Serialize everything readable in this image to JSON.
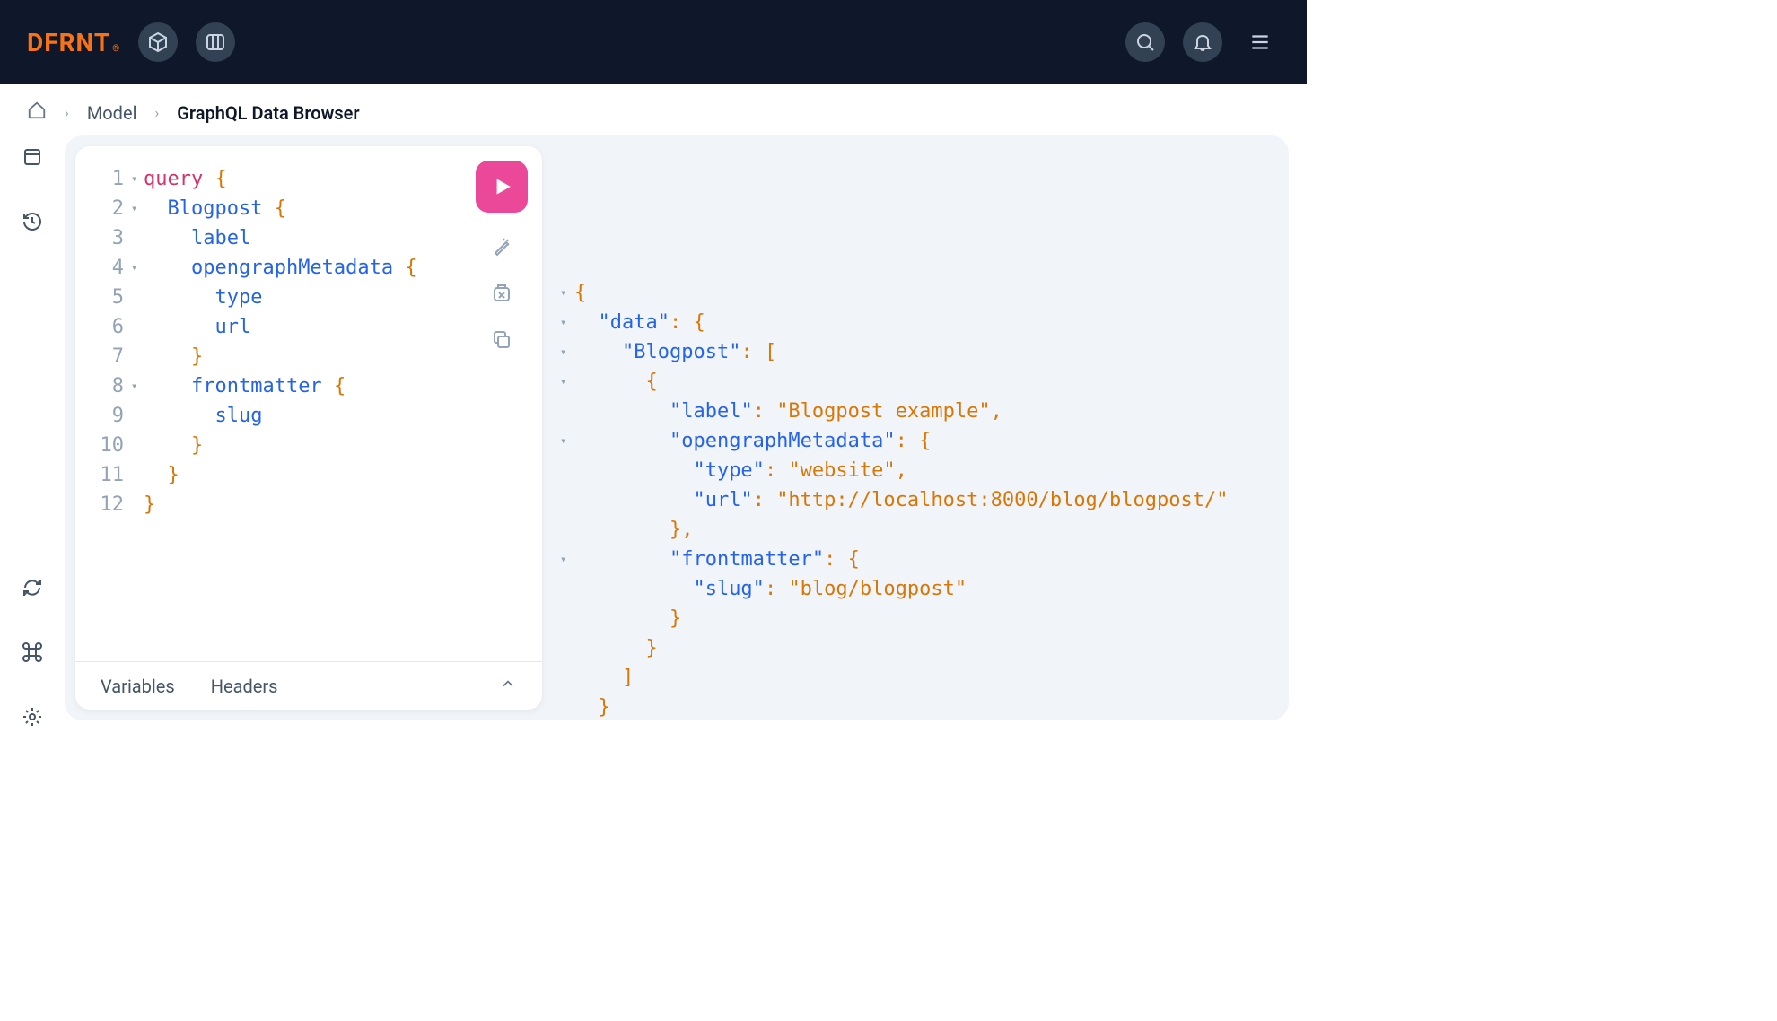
{
  "header": {
    "logo": "DFRNT",
    "logo_suffix": "®"
  },
  "breadcrumb": {
    "model": "Model",
    "current": "GraphQL Data Browser"
  },
  "editor": {
    "footer_tabs": {
      "variables": "Variables",
      "headers": "Headers"
    },
    "lines": [
      {
        "n": "1",
        "fold": "▾",
        "segs": [
          {
            "t": "query",
            "c": "kw"
          },
          {
            "t": " "
          },
          {
            "t": "{",
            "c": "brace"
          }
        ]
      },
      {
        "n": "2",
        "fold": "▾",
        "segs": [
          {
            "t": "  "
          },
          {
            "t": "Blogpost",
            "c": "type"
          },
          {
            "t": " "
          },
          {
            "t": "{",
            "c": "brace"
          }
        ]
      },
      {
        "n": "3",
        "fold": "",
        "segs": [
          {
            "t": "    "
          },
          {
            "t": "label",
            "c": "field"
          }
        ]
      },
      {
        "n": "4",
        "fold": "▾",
        "segs": [
          {
            "t": "    "
          },
          {
            "t": "opengraphMetadata",
            "c": "field"
          },
          {
            "t": " "
          },
          {
            "t": "{",
            "c": "brace"
          }
        ]
      },
      {
        "n": "5",
        "fold": "",
        "segs": [
          {
            "t": "      "
          },
          {
            "t": "type",
            "c": "field"
          }
        ]
      },
      {
        "n": "6",
        "fold": "",
        "segs": [
          {
            "t": "      "
          },
          {
            "t": "url",
            "c": "field"
          }
        ]
      },
      {
        "n": "7",
        "fold": "",
        "segs": [
          {
            "t": "    "
          },
          {
            "t": "}",
            "c": "brace"
          }
        ]
      },
      {
        "n": "8",
        "fold": "▾",
        "segs": [
          {
            "t": "    "
          },
          {
            "t": "frontmatter",
            "c": "field"
          },
          {
            "t": " "
          },
          {
            "t": "{",
            "c": "brace"
          }
        ]
      },
      {
        "n": "9",
        "fold": "",
        "segs": [
          {
            "t": "      "
          },
          {
            "t": "slug",
            "c": "field"
          }
        ]
      },
      {
        "n": "10",
        "fold": "",
        "segs": [
          {
            "t": "    "
          },
          {
            "t": "}",
            "c": "brace"
          }
        ]
      },
      {
        "n": "11",
        "fold": "",
        "segs": [
          {
            "t": "  "
          },
          {
            "t": "}",
            "c": "brace"
          }
        ]
      },
      {
        "n": "12",
        "fold": "",
        "segs": [
          {
            "t": "}",
            "c": "brace"
          }
        ]
      }
    ]
  },
  "result": {
    "lines": [
      {
        "fold": "▾",
        "segs": [
          {
            "t": "{",
            "c": "brace"
          }
        ]
      },
      {
        "fold": "▾",
        "segs": [
          {
            "t": "  "
          },
          {
            "t": "\"data\"",
            "c": "key"
          },
          {
            "t": ": ",
            "c": "punct"
          },
          {
            "t": "{",
            "c": "brace"
          }
        ]
      },
      {
        "fold": "▾",
        "segs": [
          {
            "t": "    "
          },
          {
            "t": "\"Blogpost\"",
            "c": "key"
          },
          {
            "t": ": ",
            "c": "punct"
          },
          {
            "t": "[",
            "c": "brace"
          }
        ]
      },
      {
        "fold": "▾",
        "segs": [
          {
            "t": "      "
          },
          {
            "t": "{",
            "c": "brace"
          }
        ]
      },
      {
        "fold": "",
        "segs": [
          {
            "t": "        "
          },
          {
            "t": "\"label\"",
            "c": "key"
          },
          {
            "t": ": ",
            "c": "punct"
          },
          {
            "t": "\"Blogpost example\"",
            "c": "str"
          },
          {
            "t": ",",
            "c": "punct"
          }
        ]
      },
      {
        "fold": "▾",
        "segs": [
          {
            "t": "        "
          },
          {
            "t": "\"opengraphMetadata\"",
            "c": "key"
          },
          {
            "t": ": ",
            "c": "punct"
          },
          {
            "t": "{",
            "c": "brace"
          }
        ]
      },
      {
        "fold": "",
        "segs": [
          {
            "t": "          "
          },
          {
            "t": "\"type\"",
            "c": "key"
          },
          {
            "t": ": ",
            "c": "punct"
          },
          {
            "t": "\"website\"",
            "c": "str"
          },
          {
            "t": ",",
            "c": "punct"
          }
        ]
      },
      {
        "fold": "",
        "segs": [
          {
            "t": "          "
          },
          {
            "t": "\"url\"",
            "c": "key"
          },
          {
            "t": ": ",
            "c": "punct"
          },
          {
            "t": "\"http://localhost:8000/blog/blogpost/\"",
            "c": "str"
          }
        ]
      },
      {
        "fold": "",
        "segs": [
          {
            "t": "        "
          },
          {
            "t": "}",
            "c": "brace"
          },
          {
            "t": ",",
            "c": "punct"
          }
        ]
      },
      {
        "fold": "▾",
        "segs": [
          {
            "t": "        "
          },
          {
            "t": "\"frontmatter\"",
            "c": "key"
          },
          {
            "t": ": ",
            "c": "punct"
          },
          {
            "t": "{",
            "c": "brace"
          }
        ]
      },
      {
        "fold": "",
        "segs": [
          {
            "t": "          "
          },
          {
            "t": "\"slug\"",
            "c": "key"
          },
          {
            "t": ": ",
            "c": "punct"
          },
          {
            "t": "\"blog/blogpost\"",
            "c": "str"
          }
        ]
      },
      {
        "fold": "",
        "segs": [
          {
            "t": "        "
          },
          {
            "t": "}",
            "c": "brace"
          }
        ]
      },
      {
        "fold": "",
        "segs": [
          {
            "t": "      "
          },
          {
            "t": "}",
            "c": "brace"
          }
        ]
      },
      {
        "fold": "",
        "segs": [
          {
            "t": "    "
          },
          {
            "t": "]",
            "c": "brace"
          }
        ]
      },
      {
        "fold": "",
        "segs": [
          {
            "t": "  "
          },
          {
            "t": "}",
            "c": "brace"
          }
        ]
      },
      {
        "fold": "",
        "segs": [
          {
            "t": "}",
            "c": "brace"
          }
        ]
      }
    ]
  }
}
